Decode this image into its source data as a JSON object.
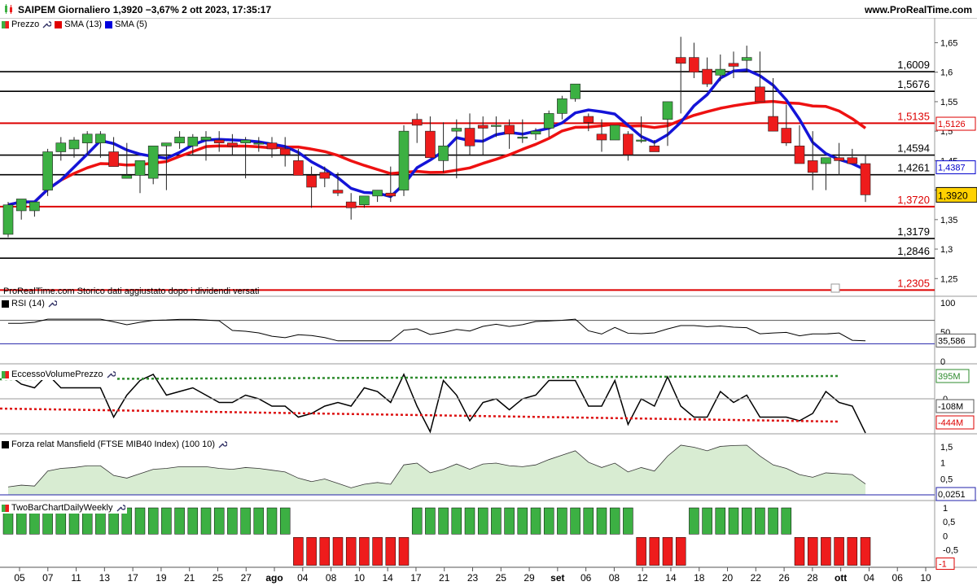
{
  "header": {
    "title": "SAIPEM Giornaliero 1,3920 −3,67% 2 ott 2023, 17:35:17",
    "brand": "www.ProRealTime.com"
  },
  "legend": [
    {
      "label": "Prezzo",
      "color": "#2e7d32"
    },
    {
      "label": "SMA (13)",
      "color": "#e00000"
    },
    {
      "label": "SMA (5)",
      "color": "#0000dd"
    }
  ],
  "note": "ProRealTime.com  Storico dati aggiustato dopo i dividendi versati",
  "colors": {
    "up": "#3cb043",
    "down": "#ee1c1c",
    "sma13": "#ee1111",
    "sma5": "#1414d8",
    "red_level": "#dd0000"
  },
  "chart_data": [
    {
      "type": "candlestick",
      "title": "SAIPEM Giornaliero",
      "x": [
        "07-03",
        "07-04",
        "07-05",
        "07-06",
        "07-07",
        "07-10",
        "07-11",
        "07-12",
        "07-13",
        "07-14",
        "07-17",
        "07-18",
        "07-19",
        "07-20",
        "07-21",
        "07-24",
        "07-25",
        "07-26",
        "07-27",
        "07-28",
        "07-31",
        "08-01",
        "08-02",
        "08-03",
        "08-04",
        "08-07",
        "08-08",
        "08-09",
        "08-10",
        "08-11",
        "08-14",
        "08-15",
        "08-16",
        "08-17",
        "08-18",
        "08-21",
        "08-22",
        "08-23",
        "08-24",
        "08-25",
        "08-28",
        "08-29",
        "08-30",
        "08-31",
        "09-01",
        "09-04",
        "09-05",
        "09-06",
        "09-07",
        "09-08",
        "09-11",
        "09-12",
        "09-13",
        "09-14",
        "09-15",
        "09-18",
        "09-19",
        "09-20",
        "09-21",
        "09-22",
        "09-25",
        "09-26",
        "09-27",
        "09-28",
        "09-29",
        "10-02"
      ],
      "open": [
        1.325,
        1.365,
        1.365,
        1.4,
        1.465,
        1.47,
        1.48,
        1.48,
        1.465,
        1.42,
        1.425,
        1.42,
        1.475,
        1.48,
        1.475,
        1.485,
        1.485,
        1.48,
        1.48,
        1.48,
        1.48,
        1.47,
        1.45,
        1.425,
        1.43,
        1.4,
        1.38,
        1.375,
        1.39,
        1.395,
        1.4,
        1.52,
        1.5,
        1.45,
        1.5,
        1.505,
        1.51,
        1.51,
        1.51,
        1.49,
        1.495,
        1.505,
        1.53,
        1.555,
        1.525,
        1.495,
        1.485,
        1.495,
        1.485,
        1.475,
        1.52,
        1.625,
        1.625,
        1.605,
        1.595,
        1.615,
        1.62,
        1.575,
        1.525,
        1.505,
        1.475,
        1.45,
        1.445,
        1.455,
        1.455,
        1.445
      ],
      "high": [
        1.38,
        1.38,
        1.38,
        1.47,
        1.49,
        1.49,
        1.5,
        1.5,
        1.49,
        1.48,
        1.44,
        1.43,
        1.48,
        1.5,
        1.495,
        1.5,
        1.5,
        1.495,
        1.49,
        1.49,
        1.49,
        1.49,
        1.47,
        1.44,
        1.44,
        1.43,
        1.395,
        1.38,
        1.4,
        1.44,
        1.51,
        1.53,
        1.525,
        1.515,
        1.52,
        1.53,
        1.525,
        1.525,
        1.52,
        1.52,
        1.505,
        1.535,
        1.56,
        1.58,
        1.53,
        1.52,
        1.51,
        1.5,
        1.525,
        1.485,
        1.55,
        1.66,
        1.65,
        1.625,
        1.63,
        1.635,
        1.645,
        1.635,
        1.59,
        1.545,
        1.51,
        1.5,
        1.45,
        1.48,
        1.47,
        1.46
      ],
      "low": [
        1.32,
        1.35,
        1.355,
        1.39,
        1.45,
        1.455,
        1.46,
        1.455,
        1.44,
        1.42,
        1.395,
        1.41,
        1.4,
        1.47,
        1.46,
        1.45,
        1.465,
        1.46,
        1.42,
        1.465,
        1.455,
        1.44,
        1.43,
        1.37,
        1.405,
        1.39,
        1.35,
        1.37,
        1.38,
        1.38,
        1.39,
        1.48,
        1.48,
        1.43,
        1.42,
        1.46,
        1.46,
        1.49,
        1.47,
        1.48,
        1.485,
        1.49,
        1.52,
        1.55,
        1.5,
        1.465,
        1.485,
        1.45,
        1.48,
        1.475,
        1.475,
        1.53,
        1.59,
        1.575,
        1.585,
        1.59,
        1.6,
        1.55,
        1.5,
        1.475,
        1.455,
        1.4,
        1.4,
        1.425,
        1.445,
        1.38
      ],
      "close": [
        1.375,
        1.385,
        1.38,
        1.465,
        1.48,
        1.485,
        1.495,
        1.495,
        1.44,
        1.425,
        1.45,
        1.475,
        1.48,
        1.49,
        1.49,
        1.49,
        1.48,
        1.475,
        1.485,
        1.48,
        1.47,
        1.46,
        1.425,
        1.405,
        1.42,
        1.395,
        1.37,
        1.39,
        1.4,
        1.39,
        1.5,
        1.51,
        1.455,
        1.475,
        1.505,
        1.475,
        1.505,
        1.51,
        1.495,
        1.49,
        1.5,
        1.53,
        1.555,
        1.58,
        1.515,
        1.485,
        1.51,
        1.46,
        1.485,
        1.465,
        1.55,
        1.615,
        1.6,
        1.58,
        1.605,
        1.61,
        1.625,
        1.55,
        1.5,
        1.48,
        1.445,
        1.43,
        1.455,
        1.45,
        1.445,
        1.392
      ],
      "sma5_visible": true,
      "sma13_visible": true,
      "y_ticks": [
        "1,65",
        "1,6",
        "1,55",
        "1,5",
        "1,45",
        "1,4",
        "1,35",
        "1,3",
        "1,25"
      ],
      "ylim": [
        1.22,
        1.67
      ],
      "levels_black": [
        "1,6009",
        "1,5676",
        "1,4594",
        "1,4261",
        "1,3179",
        "1,2846"
      ],
      "levels_red": [
        "1,5135",
        "1,3720",
        "1,2305"
      ],
      "last_labels": {
        "sma13": "1,5126",
        "sma5": "1,4387",
        "price": "1,3920"
      },
      "x_tick_labels": [
        "05",
        "07",
        "11",
        "13",
        "17",
        "19",
        "21",
        "25",
        "27",
        "ago",
        "04",
        "08",
        "10",
        "14",
        "17",
        "21",
        "23",
        "25",
        "29",
        "set",
        "06",
        "08",
        "12",
        "14",
        "18",
        "20",
        "22",
        "26",
        "28",
        "ott",
        "04",
        "06",
        "10"
      ]
    },
    {
      "type": "line",
      "title": "RSI (14)",
      "y_ticks": [
        "100",
        "50",
        "0"
      ],
      "ylim": [
        0,
        100
      ],
      "last_value": "35,586"
    },
    {
      "type": "line",
      "title": "EccessoVolumePrezzo",
      "y_ticks": [
        "0"
      ],
      "last_labels": {
        "upper": "395M",
        "value": "-108M",
        "lower": "-444M"
      }
    },
    {
      "type": "area",
      "title": "Forza relat Mansfield (FTSE MIB40 Index) (100 10)",
      "y_ticks": [
        "1,5",
        "1",
        "0,5",
        "0"
      ],
      "ylim": [
        0,
        1.6
      ],
      "last_value": "0,0251"
    },
    {
      "type": "bar",
      "title": "TwoBarChartDailyWeekly",
      "y_ticks": [
        "1",
        "0,5",
        "0",
        "-0,5"
      ],
      "ylim": [
        -1.1,
        1.1
      ],
      "last_value": "-1"
    }
  ]
}
